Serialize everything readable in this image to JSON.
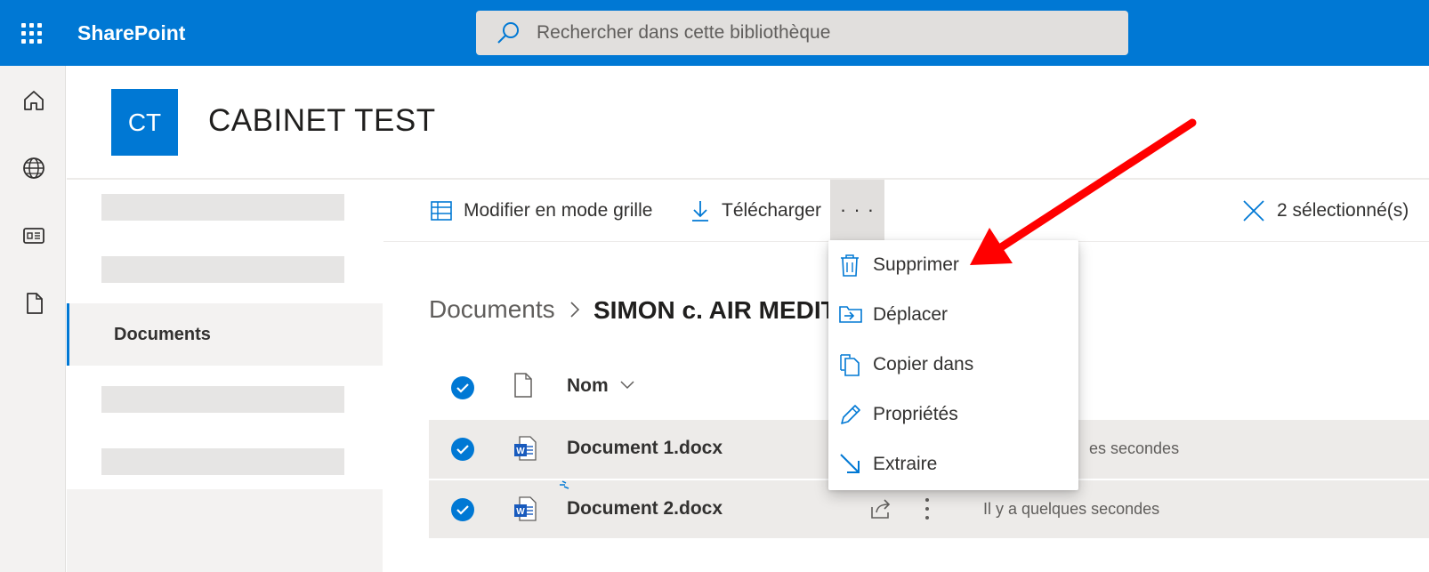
{
  "topbar": {
    "app_name": "SharePoint",
    "search_placeholder": "Rechercher dans cette bibliothèque",
    "brand_color": "#0078d4"
  },
  "rail": {
    "icons": [
      "home-icon",
      "globe-icon",
      "news-icon",
      "file-icon"
    ]
  },
  "site": {
    "logo_text": "CT",
    "title": "CABINET TEST"
  },
  "leftnav": {
    "active_label": "Documents"
  },
  "commandbar": {
    "edit_grid_label": "Modifier en mode grille",
    "download_label": "Télécharger",
    "more_label": "· · ·",
    "selection_label": "2 sélectionné(s)"
  },
  "breadcrumb": {
    "root": "Documents",
    "current": "SIMON c. AIR MEDIT"
  },
  "list": {
    "name_header": "Nom",
    "files": [
      {
        "name": "Document 1.docx",
        "modified": "es secondes",
        "selected": true
      },
      {
        "name": "Document 2.docx",
        "modified": "Il y a quelques secondes",
        "selected": true
      }
    ]
  },
  "context_menu": {
    "items": [
      {
        "label": "Supprimer",
        "icon": "trash-icon"
      },
      {
        "label": "Déplacer",
        "icon": "move-icon"
      },
      {
        "label": "Copier dans",
        "icon": "copy-icon"
      },
      {
        "label": "Propriétés",
        "icon": "pencil-icon"
      },
      {
        "label": "Extraire",
        "icon": "checkout-arrow-icon"
      }
    ]
  },
  "annotation": {
    "arrow_color": "#ff0000"
  }
}
